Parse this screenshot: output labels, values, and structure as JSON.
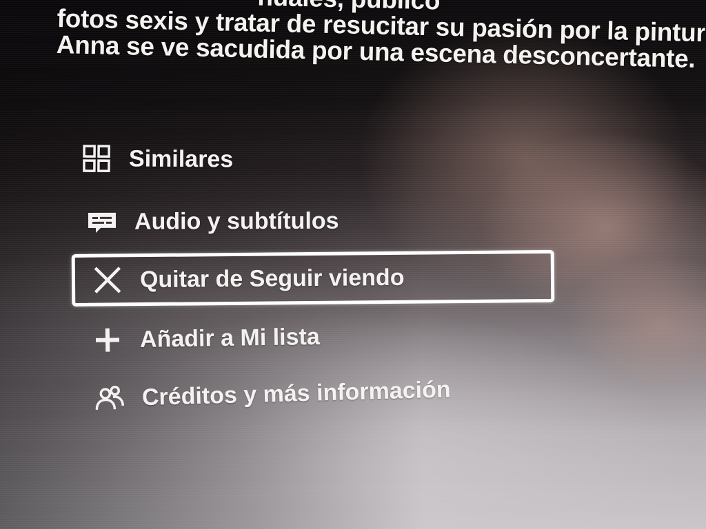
{
  "synopsis": {
    "lines": [
      "nuales, publico",
      "fotos sexis y tratar de resucitar su pasión por la pintur",
      "Anna se ve sacudida por una escena desconcertante."
    ]
  },
  "menu": {
    "focused_item": "quitar",
    "items": [
      {
        "id": "similares",
        "label": "Similares",
        "icon": "grid-icon"
      },
      {
        "id": "audio",
        "label": "Audio y subtítulos",
        "icon": "subtitles-icon"
      },
      {
        "id": "quitar",
        "label": "Quitar de Seguir viendo",
        "icon": "close-icon"
      },
      {
        "id": "anadir",
        "label": "Añadir a Mi lista",
        "icon": "plus-icon"
      },
      {
        "id": "creditos",
        "label": "Créditos y más información",
        "icon": "people-icon"
      }
    ]
  },
  "colors": {
    "text": "#f4f2f1",
    "focus_border": "#ffffff"
  }
}
